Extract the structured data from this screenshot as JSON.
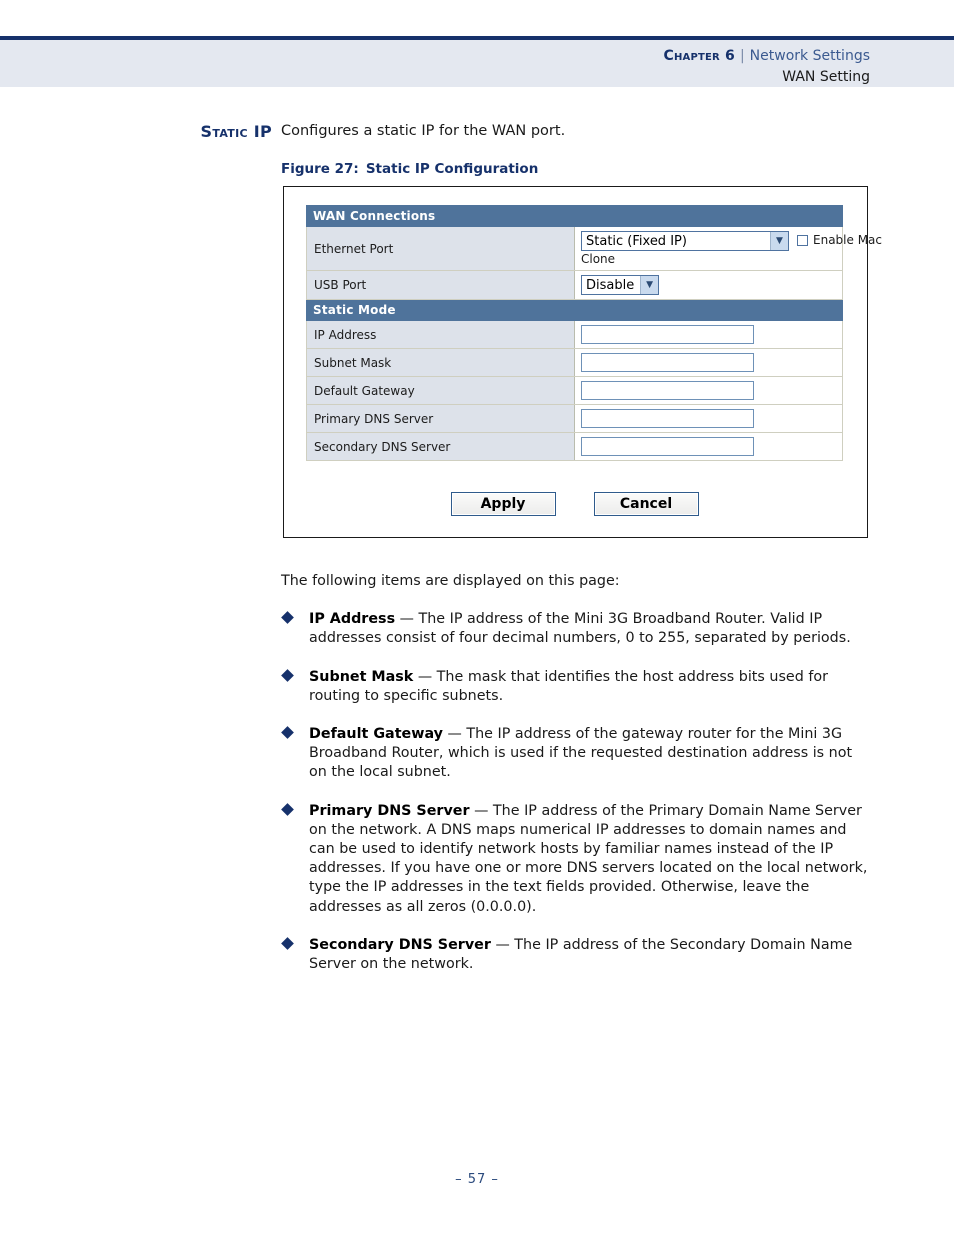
{
  "header": {
    "chapter_label": "Chapter 6",
    "separator": "|",
    "section": "Network Settings",
    "subsection": "WAN Setting"
  },
  "side_heading": "Static IP",
  "intro_text": "Configures a static IP for the WAN port.",
  "figure": {
    "number": "Figure 27:",
    "title": "Static IP Configuration",
    "panel": {
      "sections": [
        {
          "header": "WAN Connections",
          "rows": [
            {
              "label": "Ethernet Port",
              "control": "select",
              "value": "Static (Fixed IP)",
              "wrap_text": "Clone",
              "checkbox_label": "Enable Mac",
              "checkbox_checked": false
            },
            {
              "label": "USB Port",
              "control": "select",
              "value": "Disable"
            }
          ]
        },
        {
          "header": "Static Mode",
          "rows": [
            {
              "label": "IP Address",
              "control": "text",
              "value": ""
            },
            {
              "label": "Subnet Mask",
              "control": "text",
              "value": ""
            },
            {
              "label": "Default Gateway",
              "control": "text",
              "value": ""
            },
            {
              "label": "Primary DNS Server",
              "control": "text",
              "value": ""
            },
            {
              "label": "Secondary DNS Server",
              "control": "text",
              "value": ""
            }
          ]
        }
      ],
      "buttons": {
        "apply": "Apply",
        "cancel": "Cancel"
      }
    }
  },
  "body": {
    "lead": "The following items are displayed on this page:",
    "items": [
      {
        "term": "IP Address",
        "description": " — The IP address of the Mini 3G Broadband Router. Valid IP addresses consist of four decimal numbers, 0 to 255, separated by periods."
      },
      {
        "term": "Subnet Mask",
        "description": " — The mask that identifies the host address bits used for routing to specific subnets."
      },
      {
        "term": "Default Gateway",
        "description": " — The IP address of the gateway router for the Mini 3G Broadband Router, which is used if the requested destination address is not on the local subnet."
      },
      {
        "term": "Primary DNS Server",
        "description": " — The IP address of the Primary Domain Name Server on the network. A DNS maps numerical IP addresses to domain names and can be used to identify network hosts by familiar names instead of the IP addresses. If you have one or more DNS servers located on the local network, type the IP addresses in the text fields provided. Otherwise, leave the addresses as all zeros (0.0.0.0)."
      },
      {
        "term": "Secondary DNS Server",
        "description": " — The IP address of the Secondary Domain Name Server on the network."
      }
    ]
  },
  "footer": {
    "page_number": "–  57  –"
  },
  "colors": {
    "navy": "#16316b",
    "header_band": "#e4e8f0",
    "section_bar": "#4f739b",
    "label_cell": "#dde2ea",
    "input_border": "#6e91b7"
  }
}
